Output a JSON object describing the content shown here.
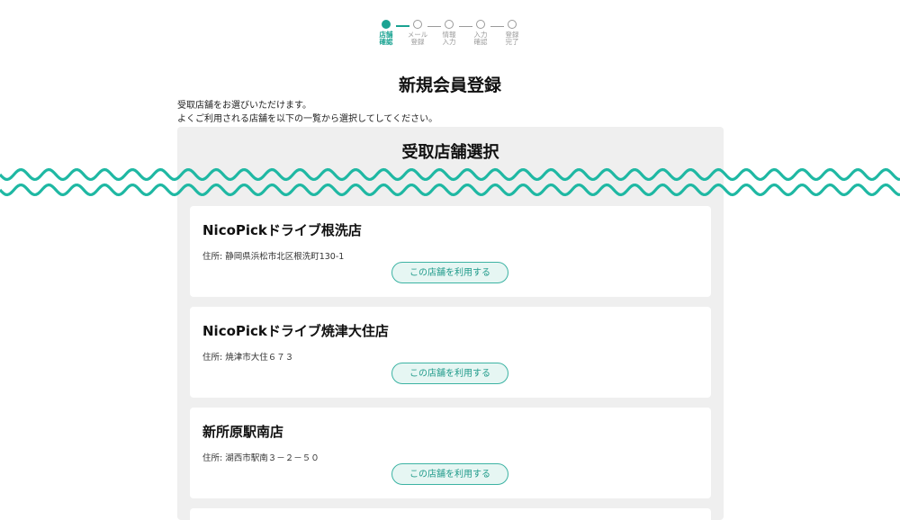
{
  "stepper": {
    "steps": [
      {
        "line1": "店舗",
        "line2": "確認",
        "active": true
      },
      {
        "line1": "メール",
        "line2": "登録",
        "active": false
      },
      {
        "line1": "情報",
        "line2": "入力",
        "active": false
      },
      {
        "line1": "入力",
        "line2": "確認",
        "active": false
      },
      {
        "line1": "登録",
        "line2": "完了",
        "active": false
      }
    ]
  },
  "page": {
    "title": "新規会員登録",
    "intro_line1": "受取店舗をお選びいただけます。",
    "intro_line2": "よくご利用される店舗を以下の一覧から選択してしてください。"
  },
  "panel": {
    "title": "受取店舗選択",
    "stores": [
      {
        "name": "NicoPickドライブ根洗店",
        "address": "住所: 静岡県浜松市北区根洗町130-1",
        "button": "この店舗を利用する"
      },
      {
        "name": "NicoPickドライブ焼津大住店",
        "address": "住所: 焼津市大住６７３",
        "button": "この店舗を利用する"
      },
      {
        "name": "新所原駅南店",
        "address": "住所: 湖西市駅南３－２－５０",
        "button": "この店舗を利用する"
      }
    ]
  },
  "colors": {
    "accent": "#1aa392",
    "panel_bg": "#efefef",
    "wave": "#1fb8a3"
  }
}
